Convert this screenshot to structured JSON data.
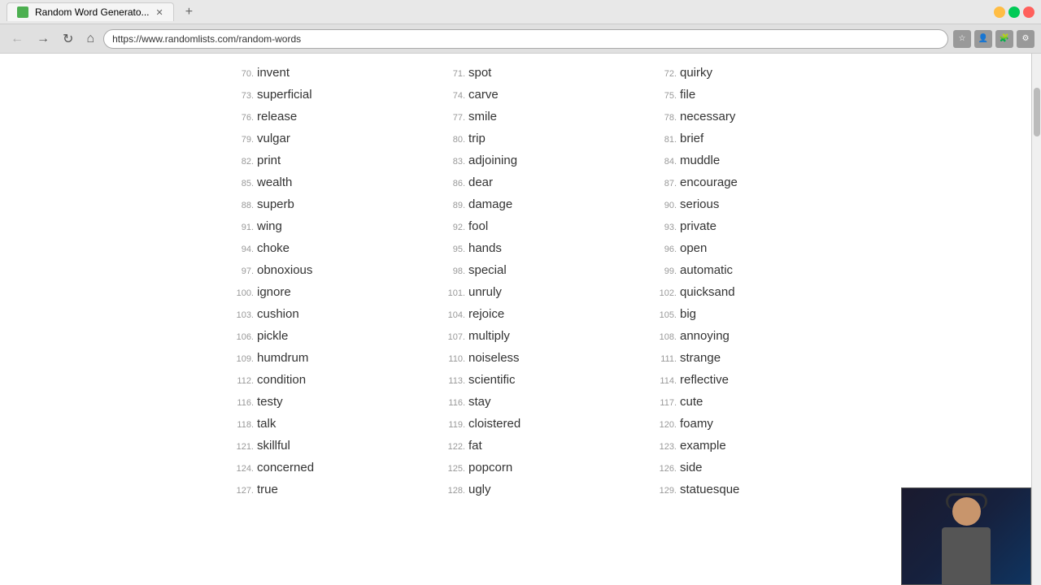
{
  "browser": {
    "tab_title": "Random Word Generato...",
    "tab_favicon": "rw",
    "address": "https://www.randomlists.com/random-words",
    "new_tab_label": "+",
    "back_label": "←",
    "forward_label": "→",
    "reload_label": "↻",
    "home_label": "⌂"
  },
  "words": [
    {
      "num": "70.",
      "word": "invent"
    },
    {
      "num": "71.",
      "word": "spot"
    },
    {
      "num": "72.",
      "word": "quirky"
    },
    {
      "num": "73.",
      "word": "superficial"
    },
    {
      "num": "74.",
      "word": "carve"
    },
    {
      "num": "75.",
      "word": "file"
    },
    {
      "num": "76.",
      "word": "release"
    },
    {
      "num": "77.",
      "word": "smile"
    },
    {
      "num": "78.",
      "word": "necessary"
    },
    {
      "num": "79.",
      "word": "vulgar"
    },
    {
      "num": "80.",
      "word": "trip"
    },
    {
      "num": "81.",
      "word": "brief"
    },
    {
      "num": "82.",
      "word": "print"
    },
    {
      "num": "83.",
      "word": "adjoining"
    },
    {
      "num": "84.",
      "word": "muddle"
    },
    {
      "num": "85.",
      "word": "wealth"
    },
    {
      "num": "86.",
      "word": "dear"
    },
    {
      "num": "87.",
      "word": "encourage"
    },
    {
      "num": "88.",
      "word": "superb"
    },
    {
      "num": "89.",
      "word": "damage"
    },
    {
      "num": "90.",
      "word": "serious"
    },
    {
      "num": "91.",
      "word": "wing"
    },
    {
      "num": "92.",
      "word": "fool"
    },
    {
      "num": "93.",
      "word": "private"
    },
    {
      "num": "94.",
      "word": "choke"
    },
    {
      "num": "95.",
      "word": "hands"
    },
    {
      "num": "96.",
      "word": "open"
    },
    {
      "num": "97.",
      "word": "obnoxious"
    },
    {
      "num": "98.",
      "word": "special"
    },
    {
      "num": "99.",
      "word": "automatic"
    },
    {
      "num": "100.",
      "word": "ignore"
    },
    {
      "num": "101.",
      "word": "unruly"
    },
    {
      "num": "102.",
      "word": "quicksand"
    },
    {
      "num": "103.",
      "word": "cushion"
    },
    {
      "num": "104.",
      "word": "rejoice"
    },
    {
      "num": "105.",
      "word": "big"
    },
    {
      "num": "106.",
      "word": "pickle"
    },
    {
      "num": "107.",
      "word": "multiply"
    },
    {
      "num": "108.",
      "word": "annoying"
    },
    {
      "num": "109.",
      "word": "humdrum"
    },
    {
      "num": "110.",
      "word": "noiseless"
    },
    {
      "num": "111.",
      "word": "strange"
    },
    {
      "num": "112.",
      "word": "condition"
    },
    {
      "num": "113.",
      "word": "scientific"
    },
    {
      "num": "114.",
      "word": "reflective"
    },
    {
      "num": "116.",
      "word": "testy"
    },
    {
      "num": "116.",
      "word": "stay"
    },
    {
      "num": "117.",
      "word": "cute"
    },
    {
      "num": "118.",
      "word": "talk"
    },
    {
      "num": "119.",
      "word": "cloistered"
    },
    {
      "num": "120.",
      "word": "foamy"
    },
    {
      "num": "121.",
      "word": "skillful"
    },
    {
      "num": "122.",
      "word": "fat"
    },
    {
      "num": "123.",
      "word": "example"
    },
    {
      "num": "124.",
      "word": "concerned"
    },
    {
      "num": "125.",
      "word": "popcorn"
    },
    {
      "num": "126.",
      "word": "side"
    },
    {
      "num": "127.",
      "word": "true"
    },
    {
      "num": "128.",
      "word": "ugly"
    },
    {
      "num": "129.",
      "word": "statuesque"
    }
  ]
}
